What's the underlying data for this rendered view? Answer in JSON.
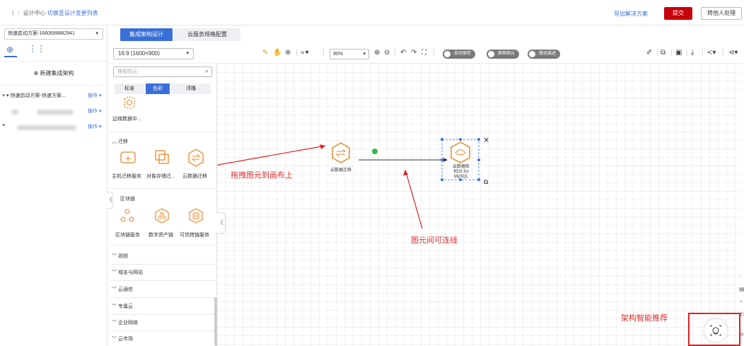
{
  "topbar": {
    "back_icon": "chevron-left-icon",
    "crumb_parent": "设计中心",
    "crumb_link": "切换至设计变更列表",
    "export_label": "导出解决方案",
    "submit_label": "提交",
    "transfer_label": "转他人处理",
    "colors": {
      "submit_bg": "#c7000b",
      "link": "#3a6fd8"
    }
  },
  "left": {
    "scheme_select": "快速启动方案-1660698882941",
    "new_arch_label": "⊕ 新建集成架构",
    "tree": [
      {
        "label": "≡ ▾ 快速启动方案-快速方案...",
        "op": "操作 ▾"
      },
      {
        "label": "",
        "op": "操作 ▾"
      },
      {
        "label": "≡",
        "op": "操作 ▾"
      }
    ]
  },
  "tabs": {
    "active": "集成架构设计",
    "other": "云服务规格配置"
  },
  "toolbar": {
    "ratio": "16:9 (1600×900)",
    "zoom": "90%",
    "toggles": [
      "自动保存",
      "推荐图元",
      "路径描述"
    ]
  },
  "palette": {
    "search_placeholder": "搜索图元",
    "segments": [
      "标准",
      "色彩",
      "浮雕"
    ],
    "edge_data_label": "边缘数据中...",
    "sections": {
      "migration": "︿ 迁移",
      "blockchain": "区块链",
      "video": "﹀ 视频",
      "domain": "﹀ 域名与网站",
      "comm": "﹀ 云通信",
      "dedicated": "﹀ 专属云",
      "enterprise": "﹀ 企业网络",
      "market": "﹀ 云市场"
    },
    "migration_items": [
      "主机迁移服务",
      "对象存储迁...",
      "云数据迁移"
    ],
    "blockchain_items": [
      "区块链服务",
      "数字资产链",
      "可信跨链服务"
    ]
  },
  "canvas": {
    "node_a_label": "云数据迁移",
    "node_b_label_lines": [
      "云数据库",
      "RDS for",
      "MySQL"
    ],
    "annotations": {
      "drag": "拖拽图元到画布上",
      "connect": "图元间可连线",
      "recommend": "架构智能推荐"
    }
  }
}
